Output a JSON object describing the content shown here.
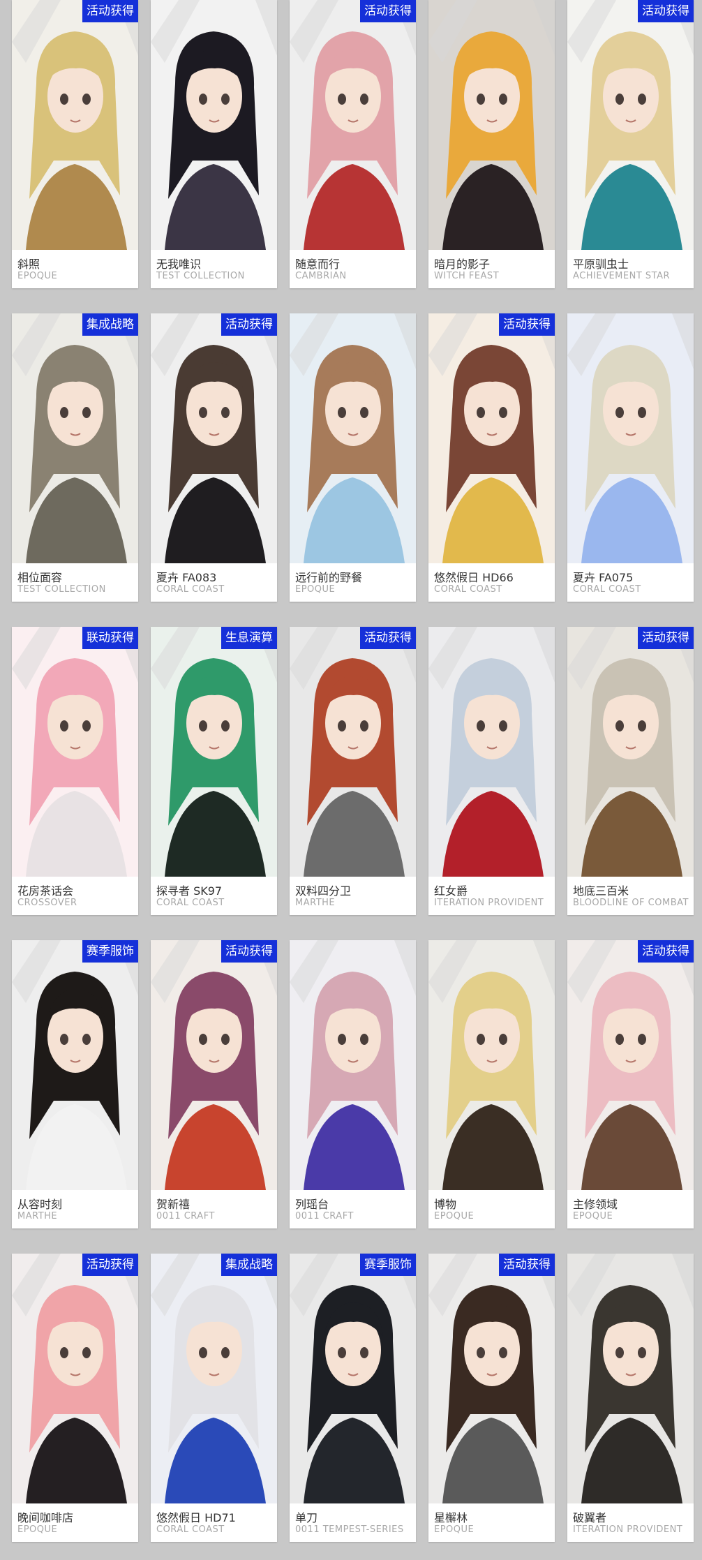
{
  "colors": {
    "page_background": "#c8c8c8",
    "card_background": "#ffffff",
    "badge_background": "#1530d9",
    "badge_text": "#ffffff",
    "name_text": "#333333",
    "series_text": "#a8a8a8"
  },
  "outfits": [
    {
      "name": "斜照",
      "series": "EPOQUE",
      "badge": "活动获得",
      "hair": "#d9c27a",
      "clothes": "#b08a4e",
      "bg": "#f1efe9"
    },
    {
      "name": "无我唯识",
      "series": "TEST COLLECTION",
      "badge": "",
      "hair": "#1c1a22",
      "clothes": "#3b3545",
      "bg": "#f2f2f2"
    },
    {
      "name": "随意而行",
      "series": "CAMBRIAN",
      "badge": "活动获得",
      "hair": "#e2a3a9",
      "clothes": "#b73434",
      "bg": "#eeeeee"
    },
    {
      "name": "暗月的影子",
      "series": "WITCH FEAST",
      "badge": "",
      "hair": "#e9a93c",
      "clothes": "#2a2224",
      "bg": "#d9d5d0"
    },
    {
      "name": "平原驯虫士",
      "series": "ACHIEVEMENT STAR",
      "badge": "活动获得",
      "hair": "#e3cf9a",
      "clothes": "#2a8a94",
      "bg": "#f3f3f0"
    },
    {
      "name": "相位面容",
      "series": "TEST COLLECTION",
      "badge": "集成战略",
      "hair": "#8a8272",
      "clothes": "#6e6a5e",
      "bg": "#ecebe6"
    },
    {
      "name": "夏卉 FA083",
      "series": "CORAL COAST",
      "badge": "活动获得",
      "hair": "#4a3b33",
      "clothes": "#1f1d20",
      "bg": "#efefef"
    },
    {
      "name": "远行前的野餐",
      "series": "EPOQUE",
      "badge": "",
      "hair": "#a77b5a",
      "clothes": "#9cc6e2",
      "bg": "#e6eef4"
    },
    {
      "name": "悠然假日 HD66",
      "series": "CORAL COAST",
      "badge": "活动获得",
      "hair": "#7a4636",
      "clothes": "#e2b94c",
      "bg": "#f5ede3"
    },
    {
      "name": "夏卉 FA075",
      "series": "CORAL COAST",
      "badge": "",
      "hair": "#ddd8c4",
      "clothes": "#9ab7ee",
      "bg": "#e9edf6"
    },
    {
      "name": "花房茶话会",
      "series": "CROSSOVER",
      "badge": "联动获得",
      "hair": "#f2a8b8",
      "clothes": "#e8e2e4",
      "bg": "#fbeff1"
    },
    {
      "name": "探寻者 SK97",
      "series": "CORAL COAST",
      "badge": "生息演算",
      "hair": "#2f9a6a",
      "clothes": "#1e2a24",
      "bg": "#eaf1ec"
    },
    {
      "name": "双料四分卫",
      "series": "MARTHE",
      "badge": "活动获得",
      "hair": "#b24a30",
      "clothes": "#6c6c6c",
      "bg": "#e8e8e8"
    },
    {
      "name": "红女爵",
      "series": "ITERATION PROVIDENT",
      "badge": "",
      "hair": "#c4cfdc",
      "clothes": "#b3202a",
      "bg": "#ececee"
    },
    {
      "name": "地底三百米",
      "series": "BLOODLINE OF COMBAT",
      "badge": "活动获得",
      "hair": "#c9c2b4",
      "clothes": "#7a5a3a",
      "bg": "#e8e5df"
    },
    {
      "name": "从容时刻",
      "series": "MARTHE",
      "badge": "赛季服饰",
      "hair": "#1e1a18",
      "clothes": "#f2f2f2",
      "bg": "#eeeeee"
    },
    {
      "name": "贺新禧",
      "series": "0011 CRAFT",
      "badge": "活动获得",
      "hair": "#8a4a6a",
      "clothes": "#c8442e",
      "bg": "#f1ece8"
    },
    {
      "name": "列瑶台",
      "series": "0011 CRAFT",
      "badge": "",
      "hair": "#d6a8b4",
      "clothes": "#4a3aa8",
      "bg": "#efeef2"
    },
    {
      "name": "博物",
      "series": "EPOQUE",
      "badge": "",
      "hair": "#e3cf8a",
      "clothes": "#3a2e24",
      "bg": "#ecebe7"
    },
    {
      "name": "主修领域",
      "series": "EPOQUE",
      "badge": "活动获得",
      "hair": "#ecbcc2",
      "clothes": "#6a4a38",
      "bg": "#f1ecea"
    },
    {
      "name": "晚间咖啡店",
      "series": "EPOQUE",
      "badge": "活动获得",
      "hair": "#f0a4a8",
      "clothes": "#241f22",
      "bg": "#f1eded"
    },
    {
      "name": "悠然假日 HD71",
      "series": "CORAL COAST",
      "badge": "集成战略",
      "hair": "#e2e2e6",
      "clothes": "#2a4ab8",
      "bg": "#eceef4"
    },
    {
      "name": "单刀",
      "series": "0011 TEMPEST-SERIES",
      "badge": "赛季服饰",
      "hair": "#1d1f24",
      "clothes": "#23262c",
      "bg": "#e9e9e9"
    },
    {
      "name": "星檞林",
      "series": "EPOQUE",
      "badge": "活动获得",
      "hair": "#3a2a22",
      "clothes": "#5a5a5a",
      "bg": "#ecebea"
    },
    {
      "name": "破翼者",
      "series": "ITERATION PROVIDENT",
      "badge": "",
      "hair": "#3a3630",
      "clothes": "#2e2b28",
      "bg": "#e7e6e4"
    }
  ]
}
